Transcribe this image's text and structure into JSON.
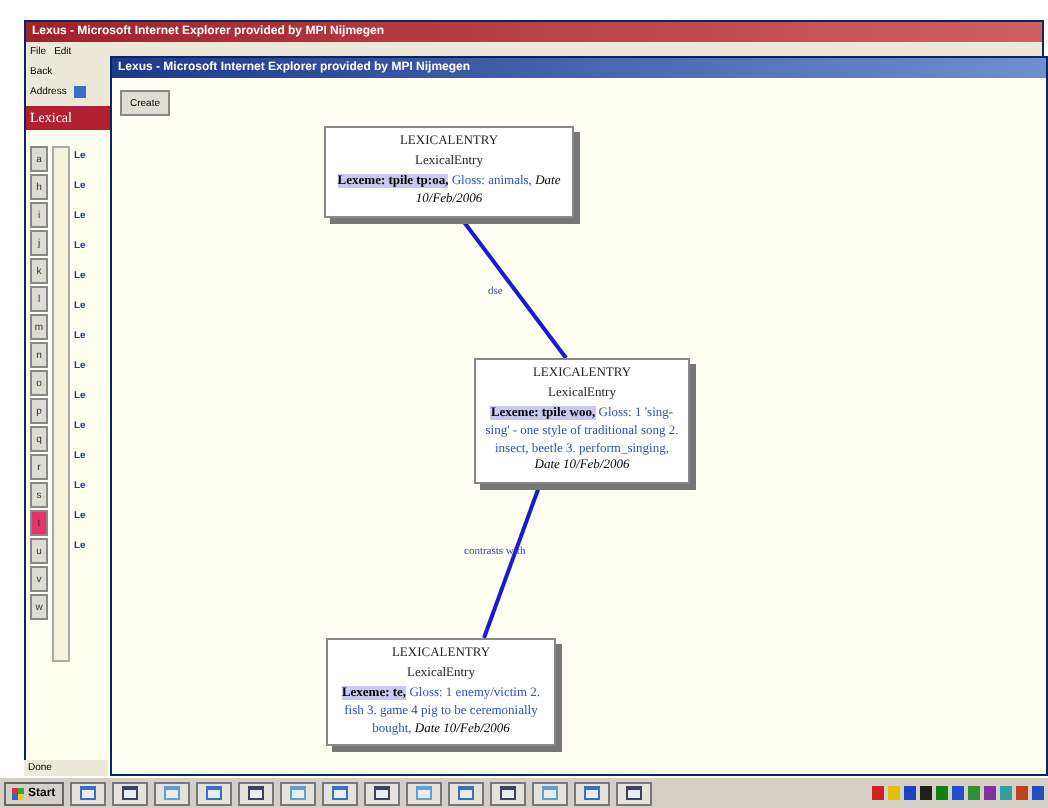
{
  "back_window": {
    "title": "Lexus - Microsoft Internet Explorer provided by MPI Nijmegen",
    "menu": [
      "File",
      "Edit"
    ],
    "back_button": "Back",
    "address_label": "Address",
    "tab": "Lexical",
    "letters": [
      {
        "label": "a",
        "selected": false
      },
      {
        "label": "h",
        "selected": false
      },
      {
        "label": "i",
        "selected": false
      },
      {
        "label": "j",
        "selected": false
      },
      {
        "label": "k",
        "selected": false
      },
      {
        "label": "l",
        "selected": false
      },
      {
        "label": "m",
        "selected": false
      },
      {
        "label": "n",
        "selected": false
      },
      {
        "label": "o",
        "selected": false
      },
      {
        "label": "p",
        "selected": false
      },
      {
        "label": "q",
        "selected": false
      },
      {
        "label": "r",
        "selected": false
      },
      {
        "label": "s",
        "selected": false
      },
      {
        "label": "t",
        "selected": true
      },
      {
        "label": "u",
        "selected": false
      },
      {
        "label": "v",
        "selected": false
      },
      {
        "label": "w",
        "selected": false
      }
    ],
    "entries": [
      "Le",
      "Le",
      "Le",
      "Le",
      "Le",
      "Le",
      "Le",
      "Le",
      "Le",
      "Le",
      "Le",
      "Le",
      "Le",
      "Le"
    ],
    "status": "Done"
  },
  "front_window": {
    "title": "Lexus - Microsoft Internet Explorer provided by MPI Nijmegen",
    "create_button": "Create",
    "nodes": [
      {
        "type": "LEXICALENTRY",
        "subtype": "LexicalEntry",
        "lexeme": "Lexeme: tpile tp:oa,",
        "gloss": "Gloss: animals,",
        "date": "Date 10/Feb/2006"
      },
      {
        "type": "LEXICALENTRY",
        "subtype": "LexicalEntry",
        "lexeme": "Lexeme: tpile woo,",
        "gloss": "Gloss: 1 'sing-sing' - one style of traditional song 2. insect, beetle 3. perform_singing,",
        "date": "Date 10/Feb/2006"
      },
      {
        "type": "LEXICALENTRY",
        "subtype": "LexicalEntry",
        "lexeme": "Lexeme: te,",
        "gloss": "Gloss: 1 enemy/victim 2. fish 3. game 4 pig to be ceremonially bought,",
        "date": "Date 10/Feb/2006"
      }
    ],
    "edges": [
      {
        "label": "dse"
      },
      {
        "label": "contrasts with"
      }
    ]
  },
  "taskbar": {
    "start": "Start"
  }
}
